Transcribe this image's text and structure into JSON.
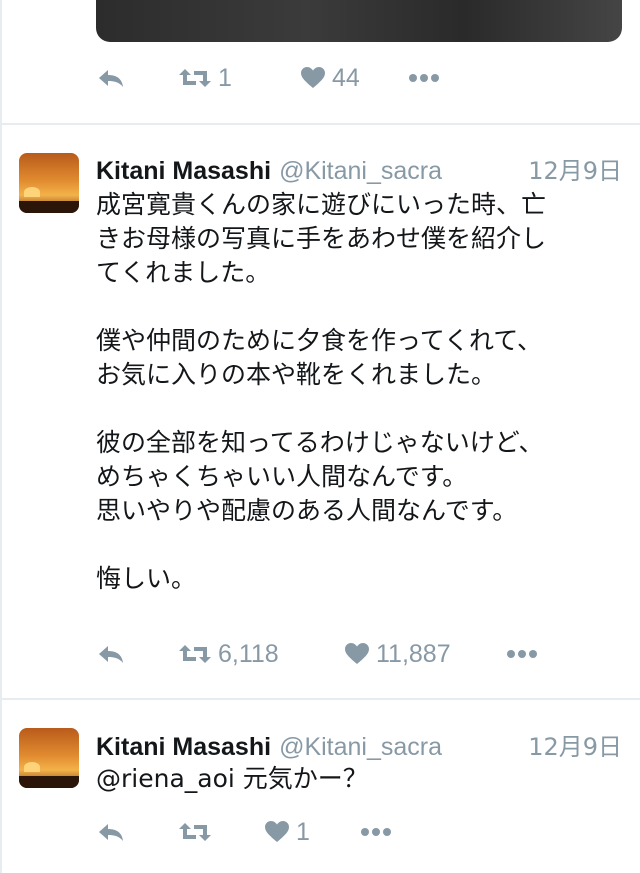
{
  "tweet_top": {
    "retweets": "1",
    "likes": "44"
  },
  "tweet_main": {
    "name": "Kitani Masashi",
    "handle": "@Kitani_sacra",
    "date": "12月9日",
    "lines": [
      "成宮寛貴くんの家に遊びにいった時、亡",
      "きお母様の写真に手をあわせ僕を紹介し",
      "てくれました。",
      "",
      "僕や仲間のために夕食を作ってくれて、",
      "お気に入りの本や靴をくれました。",
      "",
      "彼の全部を知ってるわけじゃないけど、",
      "めちゃくちゃいい人間なんです。",
      "思いやりや配慮のある人間なんです。",
      "",
      "悔しい。"
    ],
    "retweets": "6,118",
    "likes": "11,887"
  },
  "tweet_reply": {
    "name": "Kitani Masashi",
    "handle": "@Kitani_sacra",
    "date": "12月9日",
    "text": "@riena_aoi 元気かー？",
    "likes": "1"
  },
  "icons": {
    "reply": "reply-icon",
    "retweet": "retweet-icon",
    "like": "heart-icon",
    "more": "more-icon"
  },
  "colors": {
    "muted": "#8899a6",
    "text": "#14171a",
    "divider": "#e6ecf0"
  }
}
